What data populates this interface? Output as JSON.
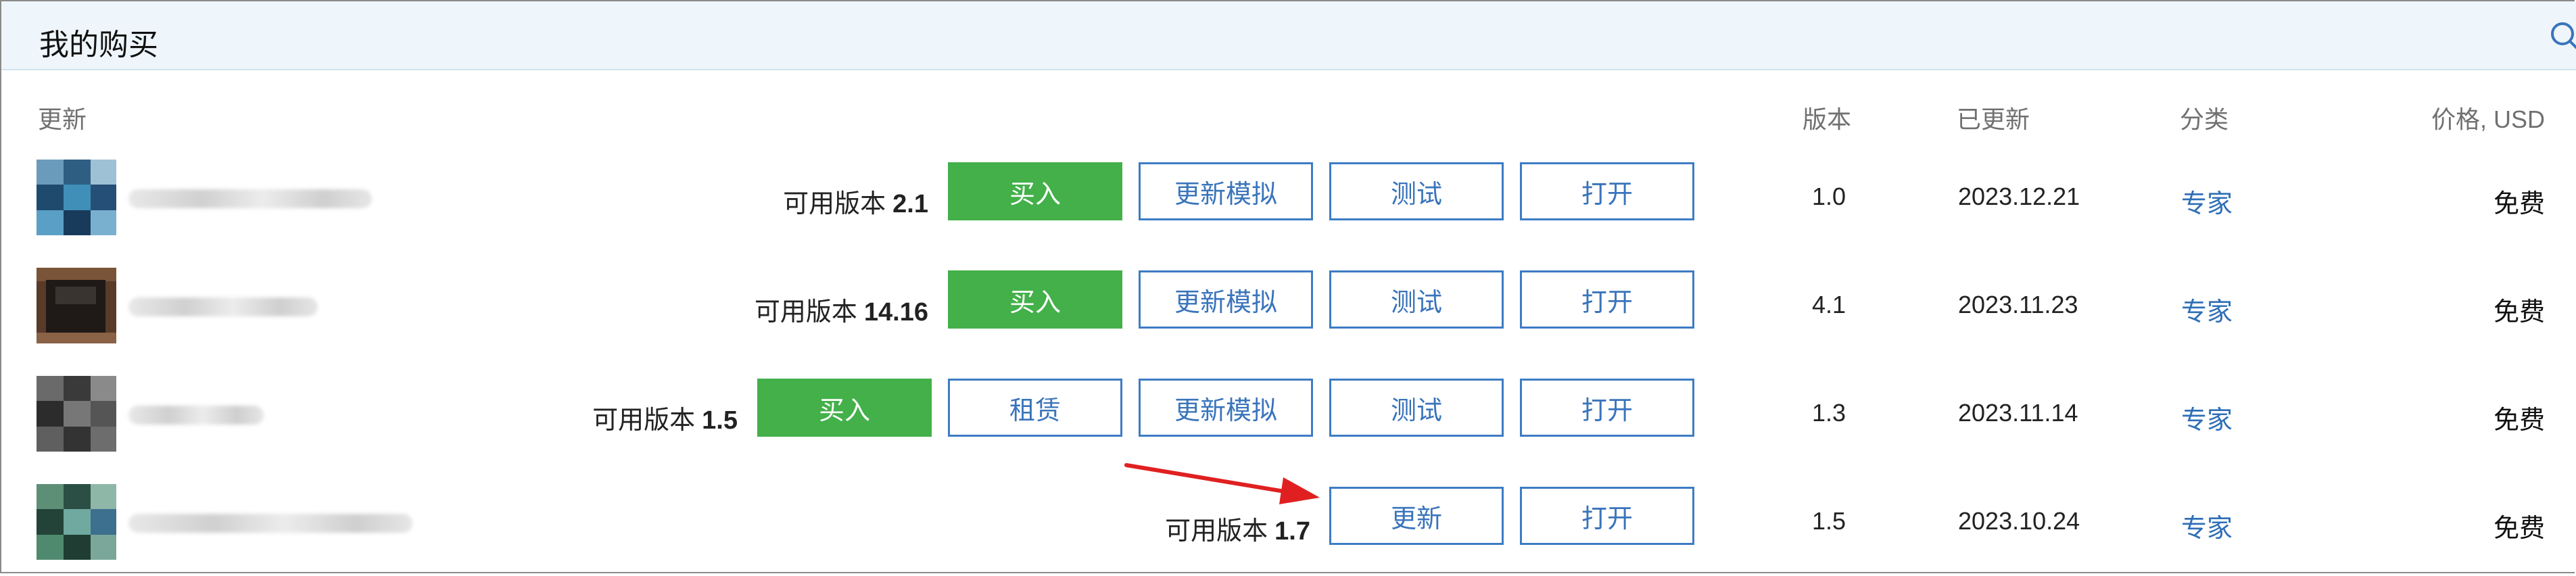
{
  "header": {
    "title": "我的购买"
  },
  "columns": {
    "update": "更新",
    "version": "版本",
    "updated": "已更新",
    "category": "分类",
    "price": "价格, USD"
  },
  "rows": [
    {
      "available_label": "可用版本",
      "available_version": "2.1",
      "buttons": [
        "买入",
        "更新模拟",
        "测试",
        "打开"
      ],
      "version": "1.0",
      "updated": "2023.12.21",
      "category": "专家",
      "price": "免费"
    },
    {
      "available_label": "可用版本",
      "available_version": "14.16",
      "buttons": [
        "买入",
        "更新模拟",
        "测试",
        "打开"
      ],
      "version": "4.1",
      "updated": "2023.11.23",
      "category": "专家",
      "price": "免费"
    },
    {
      "available_label": "可用版本",
      "available_version": "1.5",
      "buttons": [
        "买入",
        "租赁",
        "更新模拟",
        "测试",
        "打开"
      ],
      "version": "1.3",
      "updated": "2023.11.14",
      "category": "专家",
      "price": "免费"
    },
    {
      "available_label": "可用版本",
      "available_version": "1.7",
      "buttons": [
        "更新",
        "打开"
      ],
      "version": "1.5",
      "updated": "2023.10.24",
      "category": "专家",
      "price": "免费"
    }
  ],
  "colors": {
    "accent": "#3d7cc4",
    "buy_green": "#43b049",
    "header_bg": "#eef6fb",
    "arrow": "#e02020"
  },
  "icons": {
    "search": "search-icon",
    "annotation": "red-arrow-annotation"
  }
}
